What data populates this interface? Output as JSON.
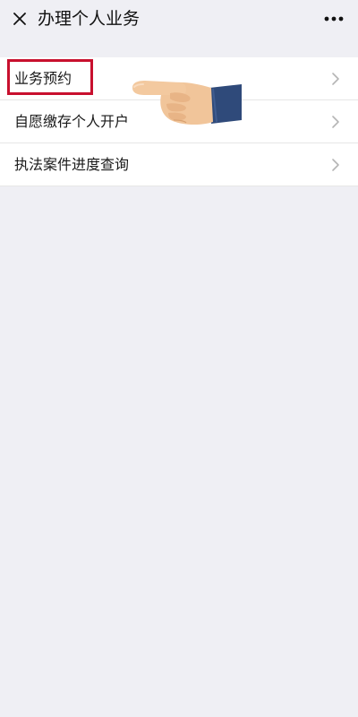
{
  "header": {
    "close_icon": "close-icon",
    "title": "办理个人业务",
    "more_icon": "more-horizontal-icon"
  },
  "menu": {
    "items": [
      {
        "label": "业务预约",
        "highlighted": true,
        "chevron_icon": "chevron-right-icon"
      },
      {
        "label": "自愿缴存个人开户",
        "highlighted": false,
        "chevron_icon": "chevron-right-icon"
      },
      {
        "label": "执法案件进度查询",
        "highlighted": false,
        "chevron_icon": "chevron-right-icon"
      }
    ]
  },
  "annotation": {
    "highlight_color": "#c8102e",
    "pointer_icon": "pointing-hand-icon"
  },
  "colors": {
    "background": "#efeff4",
    "list_background": "#ffffff",
    "text": "#1a1a1a"
  }
}
